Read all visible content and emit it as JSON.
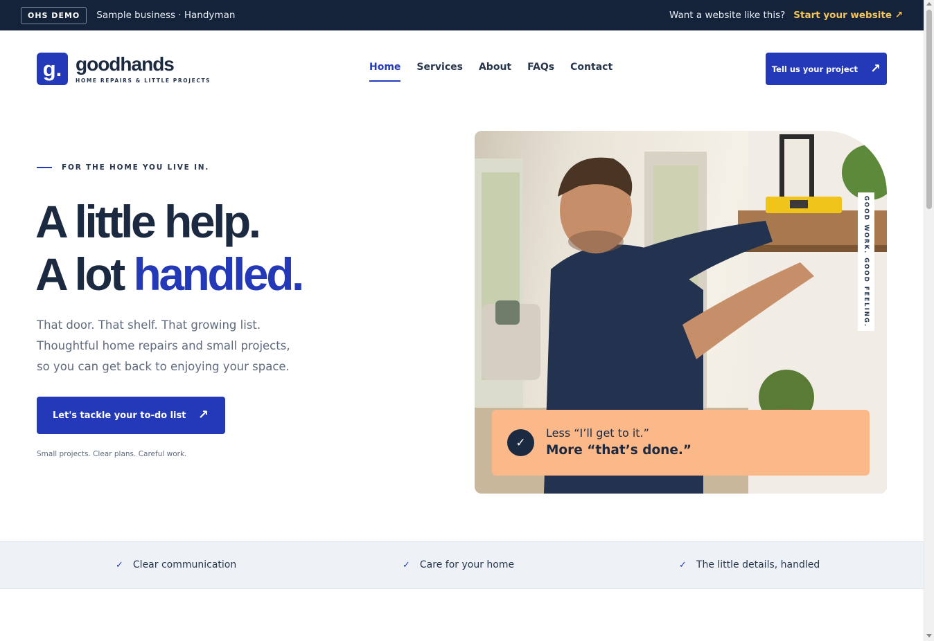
{
  "demo_bar": {
    "badge": "OHS DEMO",
    "sample": "Sample business · Handyman",
    "question": "Want a website like this?",
    "link": "Start your website ↗"
  },
  "brand": {
    "mark": "g.",
    "name": "goodhands",
    "tagline": "HOME REPAIRS & LITTLE PROJECTS"
  },
  "nav": {
    "items": [
      "Home",
      "Services",
      "About",
      "FAQs",
      "Contact"
    ],
    "active": "Home"
  },
  "header_cta": {
    "label": "Tell us your project",
    "icon": "arrow-up-right-icon"
  },
  "hero": {
    "eyebrow": "FOR THE HOME YOU LIVE IN.",
    "headline_line1": "A little help.",
    "headline_line2_plain": "A lot",
    "headline_line2_accent": "handled.",
    "intro_line1": "That door. That shelf. That growing list.",
    "intro_line2": "Thoughtful home repairs and small projects,",
    "intro_line3": "so you can get back to enjoying your space.",
    "cta_label": "Let's tackle your to-do list",
    "note": "Small projects. Clear plans. Careful work.",
    "side_tag": "GOOD WORK. GOOD FEELING.",
    "quote_line1": "Less “I’ll get to it.”",
    "quote_line2": "More “that’s done.”",
    "quote_icon": "check-icon"
  },
  "features": [
    "Clear communication",
    "Care for your home",
    "The little details, handled"
  ],
  "colors": {
    "primary": "#2439b8",
    "navy": "#14233a",
    "text": "#1b2a41",
    "accent_yellow": "#f3c45c",
    "peach": "#fbb98a",
    "strip_bg": "#eef2f7"
  }
}
